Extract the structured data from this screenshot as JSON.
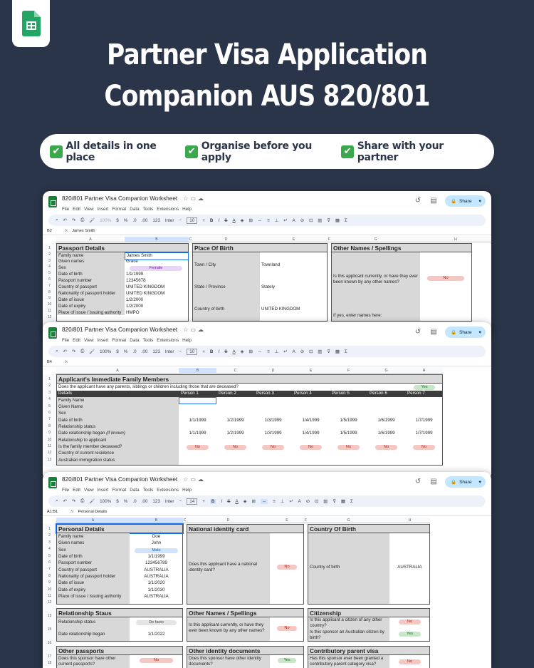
{
  "title_line1": "Partner Visa Application",
  "title_line2": "Companion AUS 820/801",
  "features": [
    "All details in one place",
    "Organise before you apply",
    "Share with your partner"
  ],
  "doc_name": "820/801 Partner Visa Companion Worksheet",
  "menu": [
    "File",
    "Edit",
    "View",
    "Insert",
    "Format",
    "Data",
    "Tools",
    "Extensions",
    "Help"
  ],
  "share_label": "Share",
  "font_name": "Inter",
  "zoom_w1": "100%",
  "zoom_w2": "100%",
  "zoom_w3": "100%",
  "font_size_w1": "10",
  "font_size_w2": "10",
  "font_size_w3": "14",
  "w1": {
    "cell_ref": "B2",
    "formula": "James Smith",
    "cols": [
      "A",
      "B",
      "C",
      "D",
      "E",
      "F",
      "G",
      "H"
    ],
    "passport_header": "Passport Details",
    "passport_rows": [
      [
        "Family name",
        "James Smith"
      ],
      [
        "Given names",
        "Grace"
      ],
      [
        "Sex",
        "Female"
      ],
      [
        "Date of birth",
        "1/1/1999"
      ],
      [
        "Passport number",
        "12345678"
      ],
      [
        "Country of passport",
        "UNITED KINGDOM"
      ],
      [
        "Nationality of passport holder",
        "UNITED KINGDOM"
      ],
      [
        "Date of issue",
        "1/2/2000"
      ],
      [
        "Date of expiry",
        "1/2/2000"
      ],
      [
        "Place of issue / issuing authority",
        "HMPO"
      ]
    ],
    "pob_header": "Place Of Birth",
    "pob_rows": [
      [
        "Town / City",
        "Townland"
      ],
      [
        "State / Province",
        "Stately"
      ],
      [
        "Country of birth",
        "UNITED KINGDOM"
      ]
    ],
    "other_header": "Other Names / Spellings",
    "other_q": "Is this applicant currently, or have they ever been known by any other names?",
    "other_ans": "No",
    "other_q2": "If yes, enter names here:"
  },
  "w2": {
    "cell_ref": "B4",
    "cols": [
      "A",
      "B",
      "C",
      "D",
      "E",
      "F",
      "G",
      "H"
    ],
    "header": "Applicant's Immediate Family Members",
    "question": "Does the applicant have any parents, siblings or children including those that are deceased?",
    "answer": "Yes",
    "details_label": "Details",
    "persons": [
      "Person 1",
      "Person 2",
      "Person 3",
      "Person 4",
      "Person 5",
      "Person 6",
      "Person 7"
    ],
    "row_labels": [
      "Family Name",
      "Given Name",
      "Sex",
      "Date of birth",
      "Relationship status",
      "Date relationship began",
      "Relationship to applicant",
      "Is the family member deceased?",
      "Country of current residence",
      "Australian immigration status"
    ],
    "if_known": "(if known)",
    "dob": [
      "1/1/1999",
      "1/2/1999",
      "1/3/1999",
      "1/4/1999",
      "1/5/1999",
      "1/6/1999",
      "1/7/1999"
    ],
    "drb": [
      "1/1/1999",
      "1/2/1999",
      "1/3/1999",
      "1/4/1999",
      "1/5/1999",
      "1/6/1999",
      "1/7/1999"
    ],
    "deceased": [
      "No",
      "No",
      "No",
      "No",
      "No",
      "No",
      "No"
    ]
  },
  "w3": {
    "cell_ref": "A1:B1",
    "formula": "Personal Details",
    "cols": [
      "A",
      "B",
      "C",
      "D",
      "E",
      "F",
      "G",
      "H"
    ],
    "personal_header": "Personal Details",
    "personal_rows": [
      [
        "Family name",
        "Doe"
      ],
      [
        "Given names",
        "John"
      ],
      [
        "Sex",
        "Male"
      ],
      [
        "Date of birth",
        "1/1/1999"
      ],
      [
        "Passport number",
        "123456789"
      ],
      [
        "Country of passport",
        "AUSTRALIA"
      ],
      [
        "Nationality of passport holder",
        "AUSTRALIA"
      ],
      [
        "Date of issue",
        "1/1/2020"
      ],
      [
        "Date of expiry",
        "1/1/2030"
      ],
      [
        "Place of issue / issuing authority",
        "AUSTRALIA"
      ]
    ],
    "nic_header": "National identity card",
    "nic_q": "Does this applicant have a national identity card?",
    "nic_ans": "No",
    "cob_header": "Country Of Birth",
    "cob_label": "Country of birth",
    "cob_val": "AUSTRALIA",
    "rel_header": "Relationship Staus",
    "rel_rows": [
      [
        "Relationship status",
        "De facto"
      ],
      [
        "Date relationship began",
        "1/1/2022"
      ]
    ],
    "onames_header": "Other Names / Spellings",
    "onames_q": "Is this applicant currently, or have they ever been known by any other names?",
    "onames_ans": "No",
    "cit_header": "Citizenship",
    "cit_q1": "Is this applicant a citizen of any other country?",
    "cit_a1": "No",
    "cit_q2": "Is this sponsor an Australian citizen by birth?",
    "cit_a2": "Yes",
    "op_header": "Other passports",
    "op_q": "Does this sponsor have other current passports?",
    "op_ans": "No",
    "oid_header": "Other identity documents",
    "oid_q": "Does this sponsor have other identity documents?",
    "oid_ans": "Yes",
    "cpv_header": "Contributory parent visa",
    "cpv_q": "Has this sponsor ever been granted a contributory parent category visa?",
    "cpv_ans": "No"
  }
}
